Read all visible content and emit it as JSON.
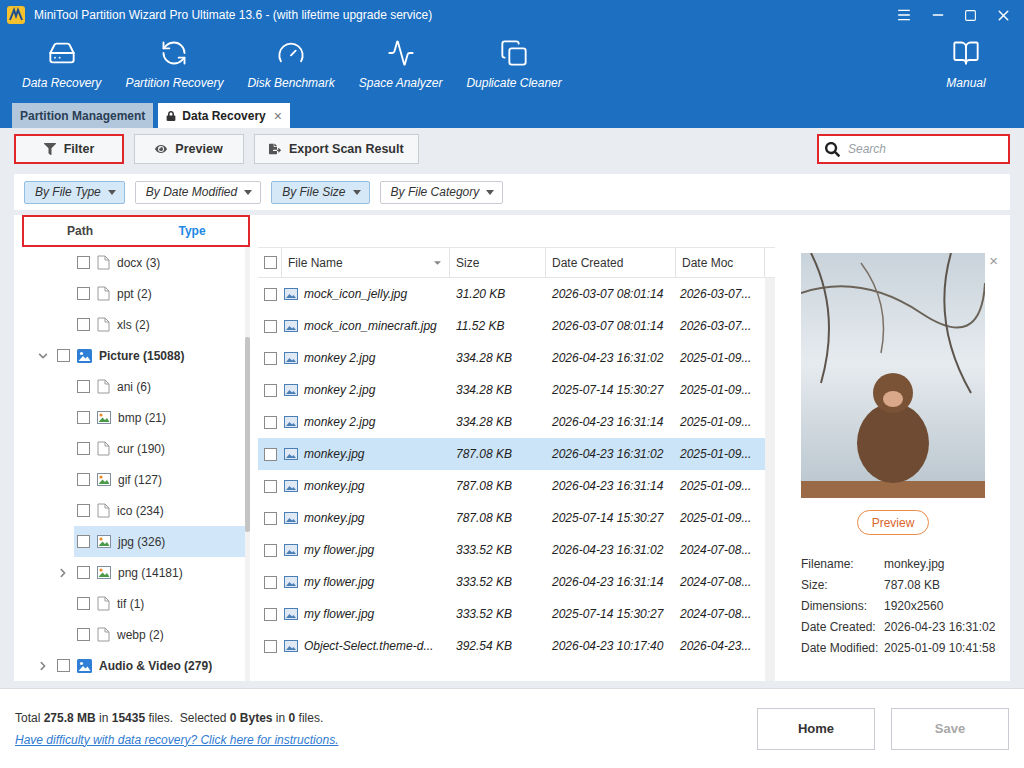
{
  "window": {
    "title": "MiniTool Partition Wizard Pro Ultimate 13.6 - (with lifetime upgrade service)"
  },
  "toolbar": [
    {
      "label": "Data Recovery"
    },
    {
      "label": "Partition Recovery"
    },
    {
      "label": "Disk Benchmark"
    },
    {
      "label": "Space Analyzer"
    },
    {
      "label": "Duplicate Cleaner"
    }
  ],
  "manual": {
    "label": "Manual"
  },
  "tabs": [
    {
      "label": "Partition Management",
      "selected": false,
      "locked": false,
      "closable": false
    },
    {
      "label": "Data Recovery",
      "selected": true,
      "locked": true,
      "closable": true
    }
  ],
  "tab_close": "×",
  "actions": [
    {
      "label": "Filter",
      "highlighted": true
    },
    {
      "label": "Preview",
      "highlighted": false
    },
    {
      "label": "Export Scan Result",
      "highlighted": false
    }
  ],
  "search": {
    "placeholder": "Search",
    "highlighted": true
  },
  "filters": [
    {
      "label": "By File Type",
      "selected": true
    },
    {
      "label": "By Date Modified",
      "selected": false
    },
    {
      "label": "By File Size",
      "selected": true
    },
    {
      "label": "By File Category",
      "selected": false
    }
  ],
  "view_tabs": {
    "highlighted": true,
    "items": [
      {
        "label": "Path",
        "selected": false
      },
      {
        "label": "Type",
        "selected": true
      }
    ]
  },
  "tree": [
    {
      "label": "docx (3)",
      "kind": "doc-type",
      "expandable": false,
      "expanded": false,
      "checked": false,
      "selected": false
    },
    {
      "label": "ppt (2)",
      "kind": "doc-type",
      "expandable": false,
      "expanded": false,
      "checked": false,
      "selected": false
    },
    {
      "label": "xls (2)",
      "kind": "doc-type",
      "expandable": false,
      "expanded": false,
      "checked": false,
      "selected": false
    },
    {
      "label": "Picture (15088)",
      "kind": "category",
      "expandable": true,
      "expanded": true,
      "checked": false,
      "selected": false
    },
    {
      "label": "ani (6)",
      "kind": "doc-type",
      "expandable": false,
      "expanded": false,
      "checked": false,
      "selected": false
    },
    {
      "label": "bmp (21)",
      "kind": "image-type",
      "expandable": false,
      "expanded": false,
      "checked": false,
      "selected": false
    },
    {
      "label": "cur (190)",
      "kind": "doc-type",
      "expandable": false,
      "expanded": false,
      "checked": false,
      "selected": false
    },
    {
      "label": "gif (127)",
      "kind": "image-type",
      "expandable": false,
      "expanded": false,
      "checked": false,
      "selected": false
    },
    {
      "label": "ico (234)",
      "kind": "doc-type",
      "expandable": false,
      "expanded": false,
      "checked": false,
      "selected": false
    },
    {
      "label": "jpg (326)",
      "kind": "image-type",
      "expandable": false,
      "expanded": false,
      "checked": false,
      "selected": true
    },
    {
      "label": "png (14181)",
      "kind": "image-type",
      "expandable": true,
      "expanded": false,
      "checked": false,
      "selected": false
    },
    {
      "label": "tif (1)",
      "kind": "doc-type",
      "expandable": false,
      "expanded": false,
      "checked": false,
      "selected": false
    },
    {
      "label": "webp (2)",
      "kind": "doc-type",
      "expandable": false,
      "expanded": false,
      "checked": false,
      "selected": false
    },
    {
      "label": "Audio & Video (279)",
      "kind": "category",
      "expandable": true,
      "expanded": false,
      "checked": false,
      "selected": false
    }
  ],
  "table": {
    "columns": [
      {
        "label": "File Name",
        "sorted": true
      },
      {
        "label": "Size",
        "sorted": false
      },
      {
        "label": "Date Created",
        "sorted": false
      },
      {
        "label": "Date Moc",
        "sorted": false
      }
    ],
    "rows": [
      {
        "name": "mock_icon_jelly.jpg",
        "size": "31.20 KB",
        "created": "2026-03-07 08:01:14",
        "modified": "2026-03-07...",
        "checked": false,
        "selected": false
      },
      {
        "name": "mock_icon_minecraft.jpg",
        "size": "11.52 KB",
        "created": "2026-03-07 08:01:14",
        "modified": "2026-03-07...",
        "checked": false,
        "selected": false
      },
      {
        "name": "monkey 2.jpg",
        "size": "334.28 KB",
        "created": "2026-04-23 16:31:02",
        "modified": "2025-01-09...",
        "checked": false,
        "selected": false
      },
      {
        "name": "monkey 2.jpg",
        "size": "334.28 KB",
        "created": "2025-07-14 15:30:27",
        "modified": "2025-01-09...",
        "checked": false,
        "selected": false
      },
      {
        "name": "monkey 2.jpg",
        "size": "334.28 KB",
        "created": "2026-04-23 16:31:14",
        "modified": "2025-01-09...",
        "checked": false,
        "selected": false
      },
      {
        "name": "monkey.jpg",
        "size": "787.08 KB",
        "created": "2026-04-23 16:31:02",
        "modified": "2025-01-09...",
        "checked": false,
        "selected": true
      },
      {
        "name": "monkey.jpg",
        "size": "787.08 KB",
        "created": "2026-04-23 16:31:14",
        "modified": "2025-01-09...",
        "checked": false,
        "selected": false
      },
      {
        "name": "monkey.jpg",
        "size": "787.08 KB",
        "created": "2025-07-14 15:30:27",
        "modified": "2025-01-09...",
        "checked": false,
        "selected": false
      },
      {
        "name": "my flower.jpg",
        "size": "333.52 KB",
        "created": "2026-04-23 16:31:02",
        "modified": "2024-07-08...",
        "checked": false,
        "selected": false
      },
      {
        "name": "my flower.jpg",
        "size": "333.52 KB",
        "created": "2026-04-23 16:31:14",
        "modified": "2024-07-08...",
        "checked": false,
        "selected": false
      },
      {
        "name": "my flower.jpg",
        "size": "333.52 KB",
        "created": "2025-07-14 15:30:27",
        "modified": "2024-07-08...",
        "checked": false,
        "selected": false
      },
      {
        "name": "Object-Select.theme-d...",
        "size": "392.54 KB",
        "created": "2026-04-23 10:17:40",
        "modified": "2026-04-23...",
        "checked": false,
        "selected": false
      }
    ]
  },
  "preview": {
    "close": "×",
    "button": "Preview",
    "fields": [
      {
        "label": "Filename:",
        "value": "monkey.jpg"
      },
      {
        "label": "Size:",
        "value": "787.08 KB"
      },
      {
        "label": "Dimensions:",
        "value": "1920x2560"
      },
      {
        "label": "Date Created:",
        "value": "2026-04-23 16:31:02"
      },
      {
        "label": "Date Modified:",
        "value": "2025-01-09 10:41:58"
      }
    ]
  },
  "status": {
    "summary": [
      {
        "text": "Total ",
        "bold": false
      },
      {
        "text": "275.8 MB",
        "bold": true
      },
      {
        "text": " in ",
        "bold": false
      },
      {
        "text": "15435",
        "bold": true
      },
      {
        "text": " files.  Selected ",
        "bold": false
      },
      {
        "text": "0 Bytes",
        "bold": true
      },
      {
        "text": " in ",
        "bold": false
      },
      {
        "text": "0",
        "bold": true
      },
      {
        "text": " files.",
        "bold": false
      }
    ],
    "link": "Have difficulty with data recovery? Click here for instructions."
  },
  "buttons": [
    {
      "label": "Home",
      "disabled": false
    },
    {
      "label": "Save",
      "disabled": true
    }
  ]
}
